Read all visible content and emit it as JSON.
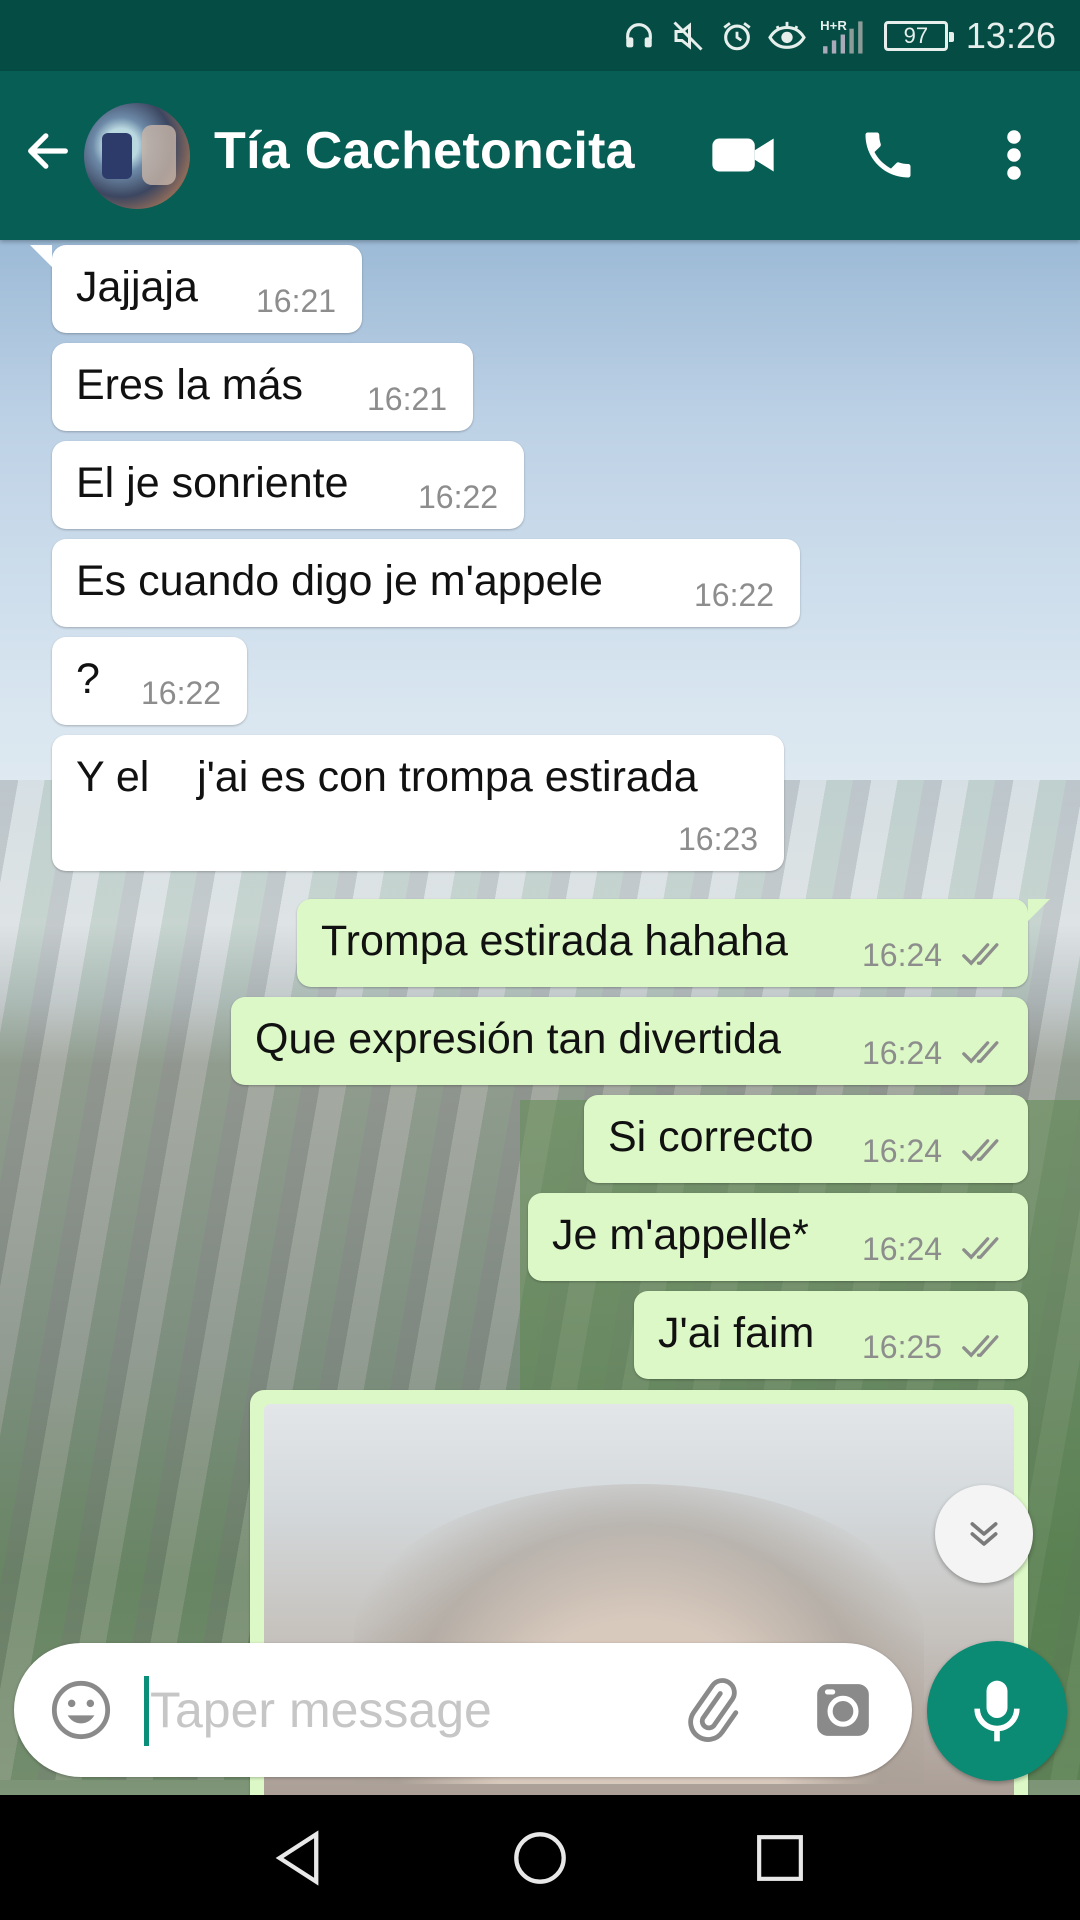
{
  "status_bar": {
    "battery": "97",
    "time": "13:26",
    "network": "H+R",
    "icons": [
      "headset-icon",
      "mute-icon",
      "alarm-icon",
      "eye-icon",
      "signal-icon",
      "battery-icon"
    ]
  },
  "header": {
    "contact_name": "Tía Cachetoncita",
    "icons": [
      "back-arrow-icon",
      "video-call-icon",
      "phone-icon",
      "more-vert-icon"
    ]
  },
  "messages": [
    {
      "direction": "in",
      "text": "Jajjaja",
      "time": "16:21"
    },
    {
      "direction": "in",
      "text": "Eres la más",
      "time": "16:21"
    },
    {
      "direction": "in",
      "text": "El je sonriente",
      "time": "16:22"
    },
    {
      "direction": "in",
      "text": "Es cuando digo je m'appele",
      "time": "16:22"
    },
    {
      "direction": "in",
      "text": "?",
      "time": "16:22"
    },
    {
      "direction": "in",
      "text": "Y el    j'ai es con trompa estirada",
      "time": "16:23"
    },
    {
      "direction": "out",
      "text": "Trompa estirada hahaha",
      "time": "16:24",
      "status": "read"
    },
    {
      "direction": "out",
      "text": "Que expresión tan divertida",
      "time": "16:24",
      "status": "read"
    },
    {
      "direction": "out",
      "text": "Si correcto",
      "time": "16:24",
      "status": "read"
    },
    {
      "direction": "out",
      "text": "Je m'appelle*",
      "time": "16:24",
      "status": "read"
    },
    {
      "direction": "out",
      "text": "J'ai faim",
      "time": "16:25",
      "status": "read"
    },
    {
      "direction": "out",
      "type": "photo"
    }
  ],
  "composer": {
    "placeholder": "Taper message",
    "icons": [
      "emoji-icon",
      "attach-icon",
      "camera-icon",
      "mic-icon"
    ]
  },
  "colors": {
    "header": "#075e54",
    "status_bar": "#054d44",
    "incoming_bubble": "#ffffff",
    "outgoing_bubble": "#dcf8c6",
    "accent": "#0b8a74",
    "read_ticks": "#8d8d8d"
  },
  "nav_bar": {
    "icons": [
      "nav-back-icon",
      "nav-home-icon",
      "nav-recents-icon"
    ]
  }
}
